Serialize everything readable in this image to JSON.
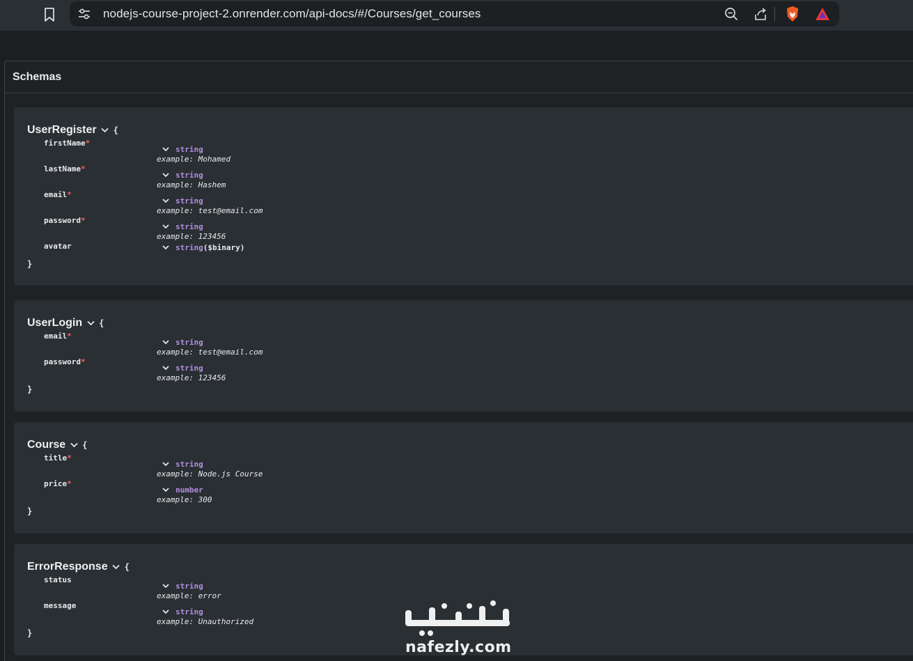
{
  "browser": {
    "url": "nodejs-course-project-2.onrender.com/api-docs/#/Courses/get_courses",
    "icons": [
      "bookmark-icon",
      "site-settings-icon",
      "zoom-out-icon",
      "share-icon",
      "brave-shields-icon",
      "brave-rewards-icon"
    ]
  },
  "schemas": {
    "title": "Schemas",
    "models": [
      {
        "name": "UserRegister",
        "open_brace": "{",
        "close_brace": "}",
        "properties": [
          {
            "name": "firstName",
            "required": "*",
            "type": "string",
            "format": "",
            "example_label": "example:",
            "example": "Mohamed"
          },
          {
            "name": "lastName",
            "required": "*",
            "type": "string",
            "format": "",
            "example_label": "example:",
            "example": "Hashem"
          },
          {
            "name": "email",
            "required": "*",
            "type": "string",
            "format": "",
            "example_label": "example:",
            "example": "test@email.com"
          },
          {
            "name": "password",
            "required": "*",
            "type": "string",
            "format": "",
            "example_label": "example:",
            "example": "123456"
          },
          {
            "name": "avatar",
            "required": "",
            "type": "string",
            "format": "($binary)",
            "example_label": "",
            "example": ""
          }
        ]
      },
      {
        "name": "UserLogin",
        "open_brace": "{",
        "close_brace": "}",
        "properties": [
          {
            "name": "email",
            "required": "*",
            "type": "string",
            "format": "",
            "example_label": "example:",
            "example": "test@email.com"
          },
          {
            "name": "password",
            "required": "*",
            "type": "string",
            "format": "",
            "example_label": "example:",
            "example": "123456"
          }
        ]
      },
      {
        "name": "Course",
        "open_brace": "{",
        "close_brace": "}",
        "properties": [
          {
            "name": "title",
            "required": "*",
            "type": "string",
            "format": "",
            "example_label": "example:",
            "example": "Node.js Course"
          },
          {
            "name": "price",
            "required": "*",
            "type": "number",
            "format": "",
            "example_label": "example:",
            "example": "300"
          }
        ]
      },
      {
        "name": "ErrorResponse",
        "open_brace": "{",
        "close_brace": "}",
        "properties": [
          {
            "name": "status",
            "required": "",
            "type": "string",
            "format": "",
            "example_label": "example:",
            "example": "error"
          },
          {
            "name": "message",
            "required": "",
            "type": "string",
            "format": "",
            "example_label": "example:",
            "example": "Unauthorized"
          }
        ]
      }
    ]
  },
  "watermark": {
    "arabic": "نفذلي",
    "latin": "nafezly.com"
  },
  "colors": {
    "type": "#b28fe0",
    "required": "#f25c5c",
    "panel": "#2a2f33",
    "page": "#1b1f22"
  }
}
